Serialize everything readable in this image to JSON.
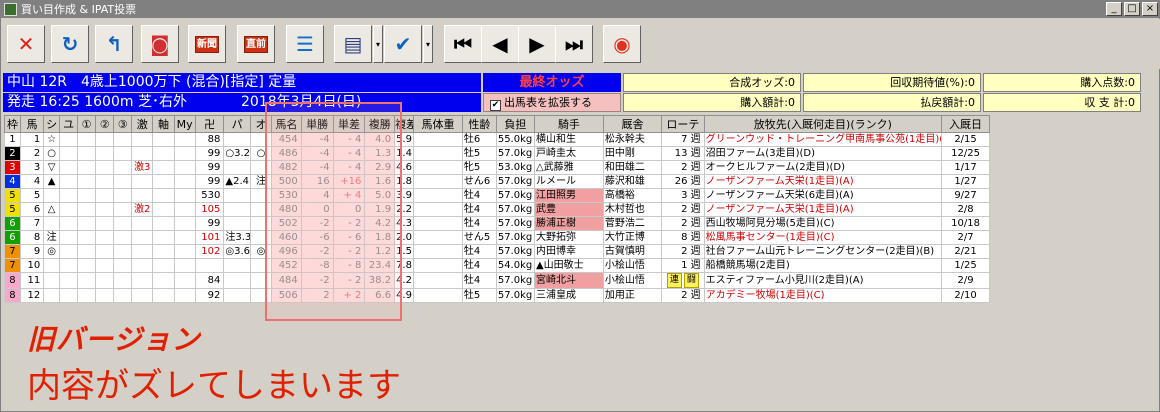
{
  "window": {
    "title": "買い目作成 & IPAT投票"
  },
  "window_buttons": [
    "_",
    "□",
    "×"
  ],
  "toolbar": {
    "buttons": [
      {
        "name": "close",
        "glyph": "✕",
        "color": "#e02020"
      },
      {
        "name": "refresh",
        "glyph": "↻",
        "color": "#1060c0"
      },
      {
        "name": "return",
        "glyph": "↰",
        "color": "#1060c0"
      },
      {
        "name": "screen",
        "glyph": "◙",
        "color": "#d03030"
      },
      {
        "name": "new",
        "label": "新聞"
      },
      {
        "name": "latest",
        "label": "直前"
      },
      {
        "name": "list",
        "glyph": "☰",
        "color": "#1070d0"
      },
      {
        "name": "memo",
        "glyph": "▤",
        "color": "#304080"
      },
      {
        "name": "ticket",
        "glyph": "✔",
        "color": "#1060c0"
      },
      {
        "name": "first",
        "glyph": "⏮",
        "color": "#000000"
      },
      {
        "name": "prev",
        "glyph": "◀",
        "color": "#000000"
      },
      {
        "name": "next",
        "glyph": "▶",
        "color": "#000000"
      },
      {
        "name": "last",
        "glyph": "⏭",
        "color": "#000000"
      },
      {
        "name": "vote",
        "glyph": "◉",
        "color": "#e03020"
      }
    ],
    "dropdown_glyph": "▾"
  },
  "race": {
    "line1": "中山 12R　4歳上1000万下 (混合)[指定] 定量",
    "line2_left": "発走 16:25 1600m 芝･右外",
    "date": "2018年3月4日(日)",
    "odds_label": "最終オッズ",
    "expand_label": "出馬表を拡張する",
    "expand_checked": "✔"
  },
  "stats": {
    "gousei": "合成オッズ:0",
    "kaishu": "回収期待値(%):0",
    "purchase_count": "購入点数:0",
    "purchase_amount": "購入額計:0",
    "refund": "払戻額計:0",
    "balance": "収 支 計:0"
  },
  "columns": [
    "枠",
    "馬",
    "シ",
    "ユ",
    "①",
    "②",
    "③",
    "激",
    "軸",
    "My",
    "卍",
    "パ",
    "オ",
    "馬名",
    "単勝",
    "単差",
    "複勝",
    "複差",
    "馬体重",
    "性齢",
    "負担",
    "騎手",
    "厩舎",
    "ローテ",
    "放牧先(入厩何走目)(ランク)",
    "入厩日"
  ],
  "rows": [
    {
      "waku": "1",
      "uma": "1",
      "shi": "☆",
      "geki": "",
      "my": "",
      "man": "88",
      "pa": "",
      "o": "",
      "bamei": "454",
      "tan": "-4",
      "tansa": "- 4",
      "fuku": "4.0",
      "fukusa": "5.9",
      "sei": "牡6",
      "futan": "55.0kg",
      "kishu": "横山和生",
      "kyusha": "松永幹夫",
      "rote": "7 週",
      "hobo": "グリーンウッド・トレーニング甲南馬事公苑(1走目)(B)",
      "red": true,
      "date": "2/15"
    },
    {
      "waku": "2",
      "uma": "2",
      "shi": "○",
      "geki": "",
      "my": "",
      "man": "99",
      "pa": "○3.2",
      "o": "○",
      "bamei": "486",
      "tan": "-4",
      "tansa": "- 4",
      "fuku": "1.3",
      "fukusa": "1.4",
      "sei": "牡5",
      "futan": "57.0kg",
      "kishu": "戸崎圭太",
      "kyusha": "田中剛",
      "rote": "13 週",
      "hobo": "沼田ファーム(3走目)(D)",
      "red": false,
      "date": "12/25"
    },
    {
      "waku": "3",
      "uma": "3",
      "shi": "▽",
      "geki": "激3",
      "my": "",
      "man": "99",
      "pa": "",
      "o": "",
      "bamei": "482",
      "tan": "-4",
      "tansa": "- 4",
      "fuku": "2.9",
      "fukusa": "4.6",
      "sei": "牝5",
      "futan": "53.0kg",
      "kishu": "△武藤雅",
      "kyusha": "和田雄二",
      "rote": "2 週",
      "hobo": "オークヒルファーム(2走目)(D)",
      "red": false,
      "date": "1/17"
    },
    {
      "waku": "4",
      "uma": "4",
      "shi": "▲",
      "geki": "",
      "my": "",
      "man": "99",
      "pa": "▲2.4",
      "o": "注",
      "bamei": "500",
      "tan": "16",
      "tansa": "+16",
      "fuku": "1.6",
      "fukusa": "1.8",
      "sei": "せん6",
      "futan": "57.0kg",
      "kishu": "ルメール",
      "kyusha": "藤沢和雄",
      "rote": "26 週",
      "hobo": "ノーザンファーム天栄(1走目)(A)",
      "red": true,
      "date": "1/27"
    },
    {
      "waku": "5",
      "uma": "5",
      "shi": "",
      "geki": "",
      "my": "",
      "man": "530",
      "pa": "",
      "o": "",
      "bamei": "530",
      "tan": "4",
      "tansa": "+ 4",
      "fuku": "5.0",
      "fukusa": "3.9",
      "sei": "牡4",
      "futan": "57.0kg",
      "kishu": "江田照男",
      "kishu_pink": true,
      "kyusha": "高橋裕",
      "rote": "3 週",
      "hobo": "ノーザンファーム天栄(6走目)(A)",
      "red": false,
      "date": "9/27"
    },
    {
      "waku": "5",
      "uma": "6",
      "shi": "△",
      "geki": "激2",
      "my": "",
      "man": "105",
      "man_red": true,
      "pa": "",
      "o": "",
      "bamei": "480",
      "tan": "0",
      "tansa": "0",
      "fuku": "1.9",
      "fukusa": "2.2",
      "sei": "牡4",
      "futan": "57.0kg",
      "kishu": "武豊",
      "kishu_pink": true,
      "kyusha": "木村哲也",
      "rote": "2 週",
      "hobo": "ノーザンファーム天栄(1走目)(A)",
      "red": true,
      "date": "2/8"
    },
    {
      "waku": "6",
      "uma": "7",
      "shi": "",
      "geki": "",
      "my": "",
      "man": "99",
      "pa": "",
      "o": "",
      "bamei": "502",
      "tan": "-2",
      "tansa": "- 2",
      "fuku": "4.2",
      "fukusa": "4.3",
      "sei": "牡4",
      "futan": "57.0kg",
      "kishu": "勝浦正樹",
      "kishu_pink": true,
      "kyusha": "菅野浩二",
      "rote": "2 週",
      "hobo": "西山牧場阿見分場(5走目)(C)",
      "red": false,
      "date": "10/18"
    },
    {
      "waku": "6",
      "uma": "8",
      "shi": "注",
      "geki": "",
      "my": "",
      "man": "101",
      "man_red": true,
      "pa": "注3.3",
      "o": "",
      "bamei": "460",
      "tan": "-6",
      "tansa": "- 6",
      "fuku": "1.8",
      "fukusa": "2.0",
      "sei": "せん5",
      "futan": "57.0kg",
      "kishu": "大野拓弥",
      "kyusha": "大竹正博",
      "rote": "8 週",
      "hobo": "松風馬事センター(1走目)(C)",
      "red": true,
      "date": "2/7"
    },
    {
      "waku": "7",
      "uma": "9",
      "shi": "◎",
      "geki": "",
      "my": "",
      "man": "102",
      "man_red": true,
      "pa": "◎3.6",
      "o": "◎",
      "bamei": "496",
      "tan": "-2",
      "tansa": "- 2",
      "fuku": "1.2",
      "fukusa": "1.5",
      "sei": "牡4",
      "futan": "57.0kg",
      "kishu": "内田博幸",
      "kyusha": "古賀慎明",
      "rote": "2 週",
      "hobo": "社台ファーム山元トレーニングセンター(2走目)(B)",
      "red": false,
      "date": "2/21"
    },
    {
      "waku": "7",
      "uma": "10",
      "shi": "",
      "geki": "",
      "my": "",
      "man": "",
      "pa": "",
      "o": "",
      "bamei": "452",
      "tan": "-8",
      "tansa": "- 8",
      "fuku": "23.4",
      "fukusa": "7.8",
      "sei": "牡4",
      "futan": "54.0kg",
      "kishu": "▲山田敬士",
      "kyusha": "小桧山悟",
      "rote": "1 週",
      "hobo": "船橋競馬場(2走目)",
      "red": false,
      "date": "1/25"
    },
    {
      "waku": "8",
      "uma": "11",
      "shi": "",
      "geki": "",
      "my": "",
      "man": "84",
      "pa": "",
      "o": "",
      "bamei": "484",
      "tan": "-2",
      "tansa": "- 2",
      "fuku": "38.2",
      "fukusa": "4.2",
      "sei": "牡4",
      "futan": "57.0kg",
      "kishu": "宮崎北斗",
      "kishu_pink": true,
      "kyusha": "小桧山悟",
      "rote": "連 闘",
      "rote_badge": true,
      "hobo": "エスティファーム小見川(2走目)(A)",
      "red": false,
      "date": "2/9"
    },
    {
      "waku": "8",
      "uma": "12",
      "shi": "",
      "geki": "",
      "my": "",
      "man": "92",
      "pa": "",
      "o": "",
      "bamei": "506",
      "tan": "2",
      "tansa": "+ 2",
      "fuku": "6.6",
      "fukusa": "4.9",
      "sei": "牡5",
      "futan": "57.0kg",
      "kishu": "三浦皇成",
      "kyusha": "加用正",
      "rote": "2 週",
      "hobo": "アカデミー牧場(1走目)(C)",
      "red": true,
      "date": "2/10"
    }
  ],
  "waku_colors": {
    "1": "#ffffff",
    "2": "#000000",
    "3": "#e00000",
    "4": "#0030e0",
    "5": "#f0e000",
    "6": "#10a000",
    "7": "#f09000",
    "8": "#f8a8c8"
  },
  "annotation": {
    "title": "旧バージョン",
    "subtitle": "内容がズレてしまいます"
  }
}
